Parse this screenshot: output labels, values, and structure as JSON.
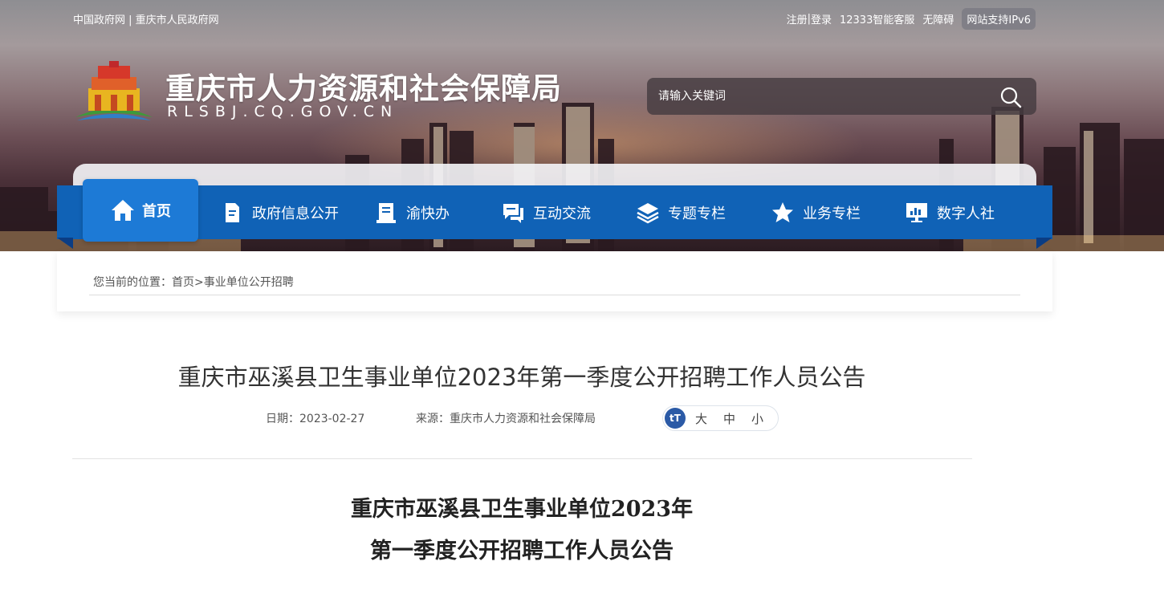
{
  "topbar": {
    "gov_links": [
      "中国政府网",
      "重庆市人民政府网"
    ],
    "separator": " | ",
    "user_links": [
      "注册",
      "登录"
    ],
    "service": "12333智能客服",
    "accessibility": "无障碍",
    "ipv6": "网站支持IPv6"
  },
  "header": {
    "title": "重庆市人力资源和社会保障局",
    "domain": "RLSBJ.CQ.GOV.CN",
    "search_placeholder": "请输入关键词"
  },
  "nav": {
    "items": [
      {
        "label": "首页",
        "icon": "home-icon"
      },
      {
        "label": "政府信息公开",
        "icon": "document-icon"
      },
      {
        "label": "渝快办",
        "icon": "book-icon"
      },
      {
        "label": "互动交流",
        "icon": "chat-icon"
      },
      {
        "label": "专题专栏",
        "icon": "layers-icon"
      },
      {
        "label": "业务专栏",
        "icon": "star-icon"
      },
      {
        "label": "数字人社",
        "icon": "monitor-icon"
      }
    ]
  },
  "breadcrumb": {
    "prefix": "您当前的位置：",
    "home": "首页",
    "sep": ">",
    "current": "事业单位公开招聘"
  },
  "article": {
    "title": "重庆市巫溪县卫生事业单位2023年第一季度公开招聘工作人员公告",
    "date_label": "日期：",
    "date": "2023-02-27",
    "source_label": "来源：",
    "source": "重庆市人力资源和社会保障局",
    "font_sizes": [
      "大",
      "中",
      "小"
    ],
    "font_icon_text": "tT",
    "body_heading_line1": "重庆市巫溪县卫生事业单位2023年",
    "body_heading_line2": "第一季度公开招聘工作人员公告"
  },
  "colors": {
    "nav_blue": "#1062b6",
    "nav_active": "#1d7ad6",
    "font_icon": "#2b5aa6"
  }
}
